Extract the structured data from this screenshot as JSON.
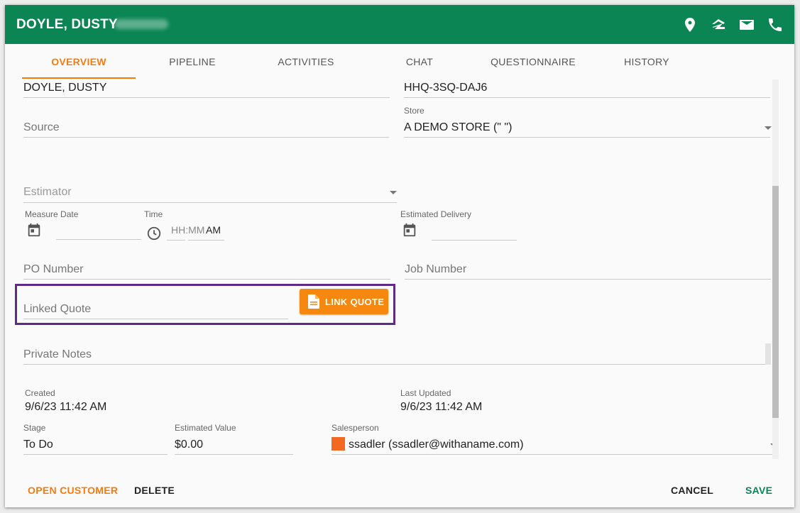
{
  "header": {
    "title": "DOYLE, DUSTY",
    "bg_color": "#0a8553",
    "icons": [
      "location-pin-icon",
      "zillow-icon",
      "email-icon",
      "phone-icon"
    ]
  },
  "tabs": [
    {
      "label": "OVERVIEW",
      "active": true
    },
    {
      "label": "PIPELINE"
    },
    {
      "label": "ACTIVITIES"
    },
    {
      "label": "CHAT"
    },
    {
      "label": "QUESTIONNAIRE"
    },
    {
      "label": "HISTORY"
    }
  ],
  "accent_color": "#f47c0f",
  "form": {
    "customer_name": "DOYLE, DUSTY",
    "quote_code": "HHQ-3SQ-DAJ6",
    "source_placeholder": "Source",
    "store_label": "Store",
    "store_value": "A DEMO STORE (\" \")",
    "estimator_placeholder": "Estimator",
    "measure_date_label": "Measure Date",
    "time_label": "Time",
    "time_placeholder": "HH:MM",
    "time_ampm": "AM",
    "estimated_delivery_label": "Estimated Delivery",
    "po_number_placeholder": "PO Number",
    "job_number_placeholder": "Job Number",
    "linked_quote_placeholder": "Linked Quote",
    "link_quote_button": "LINK QUOTE",
    "private_notes_placeholder": "Private Notes",
    "created_label": "Created",
    "created_value": "9/6/23 11:42 AM",
    "last_updated_label": "Last Updated",
    "last_updated_value": "9/6/23 11:42 AM",
    "stage_label": "Stage",
    "stage_value": "To Do",
    "estimated_value_label": "Estimated Value",
    "estimated_value": "$0.00",
    "salesperson_label": "Salesperson",
    "salesperson_value": "ssadler (ssadler@withaname.com)",
    "salesperson_color": "#f26a21"
  },
  "footer": {
    "open_customer": "OPEN CUSTOMER",
    "delete": "DELETE",
    "cancel": "CANCEL",
    "save": "SAVE"
  }
}
